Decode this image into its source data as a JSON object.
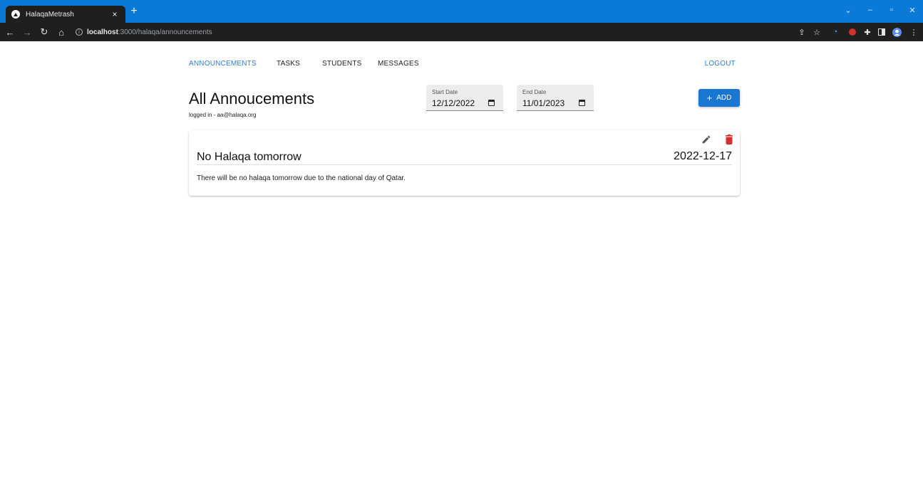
{
  "browser": {
    "tab_title": "HalaqaMetrash",
    "tab_close": "×",
    "new_tab": "+",
    "url_host": "localhost",
    "url_rest": ":3000/halaqa/announcements",
    "icons": [
      "back-icon",
      "forward-icon",
      "reload-icon",
      "home-icon",
      "info-icon",
      "share-icon",
      "star-icon",
      "extension-icon",
      "puzzle-icon",
      "sidebar-icon",
      "profile-icon",
      "menu-icon"
    ]
  },
  "nav": {
    "items": [
      "ANNOUNCEMENTS",
      "TASKS",
      "STUDENTS",
      "MESSAGES"
    ],
    "active": "ANNOUNCEMENTS",
    "logout": "LOGOUT"
  },
  "header": {
    "title": "All Annoucements",
    "logged_in": "logged in - aa@halaqa.org"
  },
  "filters": {
    "start_label": "Start Date",
    "start_value": "12/12/2022",
    "end_label": "End Date",
    "end_value": "11/01/2023"
  },
  "add_button": {
    "icon": "+",
    "label": "ADD"
  },
  "announcements": [
    {
      "title": "No Halaqa tomorrow",
      "date": "2022-12-17",
      "body": "There will be no halaqa tomorrow due to the national day of Qatar."
    }
  ],
  "colors": {
    "accent": "#1976d2",
    "nav_active": "#2f7dd6",
    "delete": "#d32f2f",
    "browser_frame": "#0b7ad6"
  }
}
